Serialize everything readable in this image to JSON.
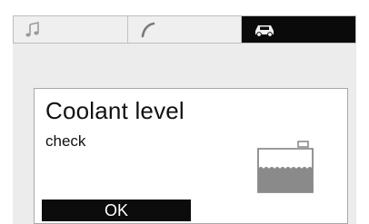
{
  "tabs": [
    {
      "icon": "music-note-icon",
      "active": false
    },
    {
      "icon": "phone-icon",
      "active": false
    },
    {
      "icon": "car-icon",
      "active": true
    }
  ],
  "dialog": {
    "title": "Coolant level",
    "subtitle": "check",
    "icon": "coolant-tank-icon",
    "ok_label": "OK"
  },
  "colors": {
    "active_tab": "#0a0a0a",
    "coolant_fill": "#8a8a8a",
    "ok_button": "#0c0c0c"
  }
}
